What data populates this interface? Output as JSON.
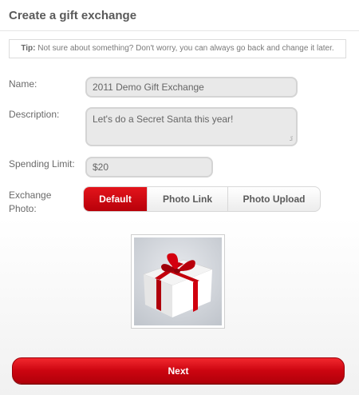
{
  "page": {
    "title": "Create a gift exchange"
  },
  "tip": {
    "prefix": "Tip:",
    "text": " Not sure about something? Don't worry, you can always go back and change it later."
  },
  "form": {
    "name_label": "Name:",
    "name_value": "2011 Demo Gift Exchange",
    "description_label": "Description:",
    "description_value": "Let's do a Secret Santa this year!",
    "spending_limit_label": "Spending Limit:",
    "spending_limit_value": "$20",
    "exchange_photo_label_line1": "Exchange",
    "exchange_photo_label_line2": "Photo:"
  },
  "photo_options": {
    "selected": "Default",
    "options": [
      "Default",
      "Photo Link",
      "Photo Upload"
    ]
  },
  "colors": {
    "accent": "#cc0510",
    "ribbon": "#c3000c"
  },
  "actions": {
    "next_label": "Next"
  }
}
